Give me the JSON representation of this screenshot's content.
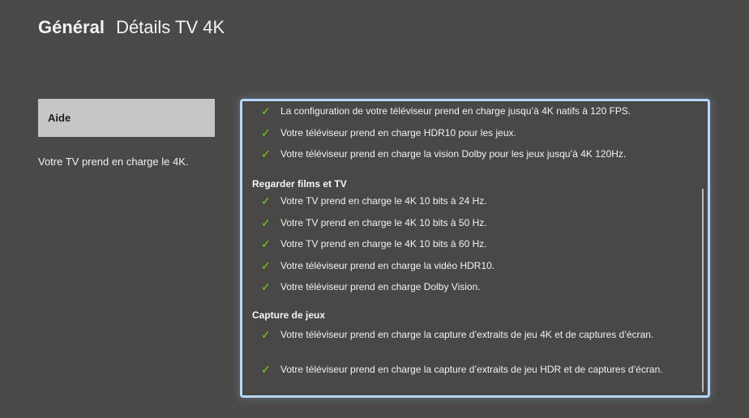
{
  "header": {
    "section": "Général",
    "title": "Détails TV 4K"
  },
  "left": {
    "aide_button": "Aide",
    "support_text": "Votre TV prend en charge le 4K."
  },
  "panel": {
    "items": [
      "La configuration de votre téléviseur prend en charge jusqu’à 4K natifs à 120 FPS.",
      "Votre téléviseur prend en charge HDR10 pour les jeux.",
      "Votre téléviseur prend en charge la vision Dolby pour les jeux jusqu’à 4K 120Hz."
    ],
    "sections": [
      {
        "title": "Regarder films et TV",
        "items": [
          "Votre TV prend en charge le 4K 10 bits à 24 Hz.",
          "Votre TV prend en charge le 4K 10 bits à 50 Hz.",
          "Votre TV prend en charge le 4K 10 bits à 60 Hz.",
          "Votre téléviseur prend en charge la vidéo HDR10.",
          "Votre téléviseur prend en charge Dolby Vision."
        ]
      },
      {
        "title": "Capture de jeux",
        "items": [
          "Votre téléviseur prend en charge la capture d’extraits de jeu 4K et de captures d’écran.",
          "Votre téléviseur prend en charge la capture d’extraits de jeu HDR et de captures d’écran."
        ]
      }
    ]
  },
  "colors": {
    "background": "#4b4948",
    "panel_border": "#b8d7f6",
    "check": "#73d216",
    "button_bg": "#c8c6c4"
  },
  "icons": {
    "check": "check-icon"
  }
}
